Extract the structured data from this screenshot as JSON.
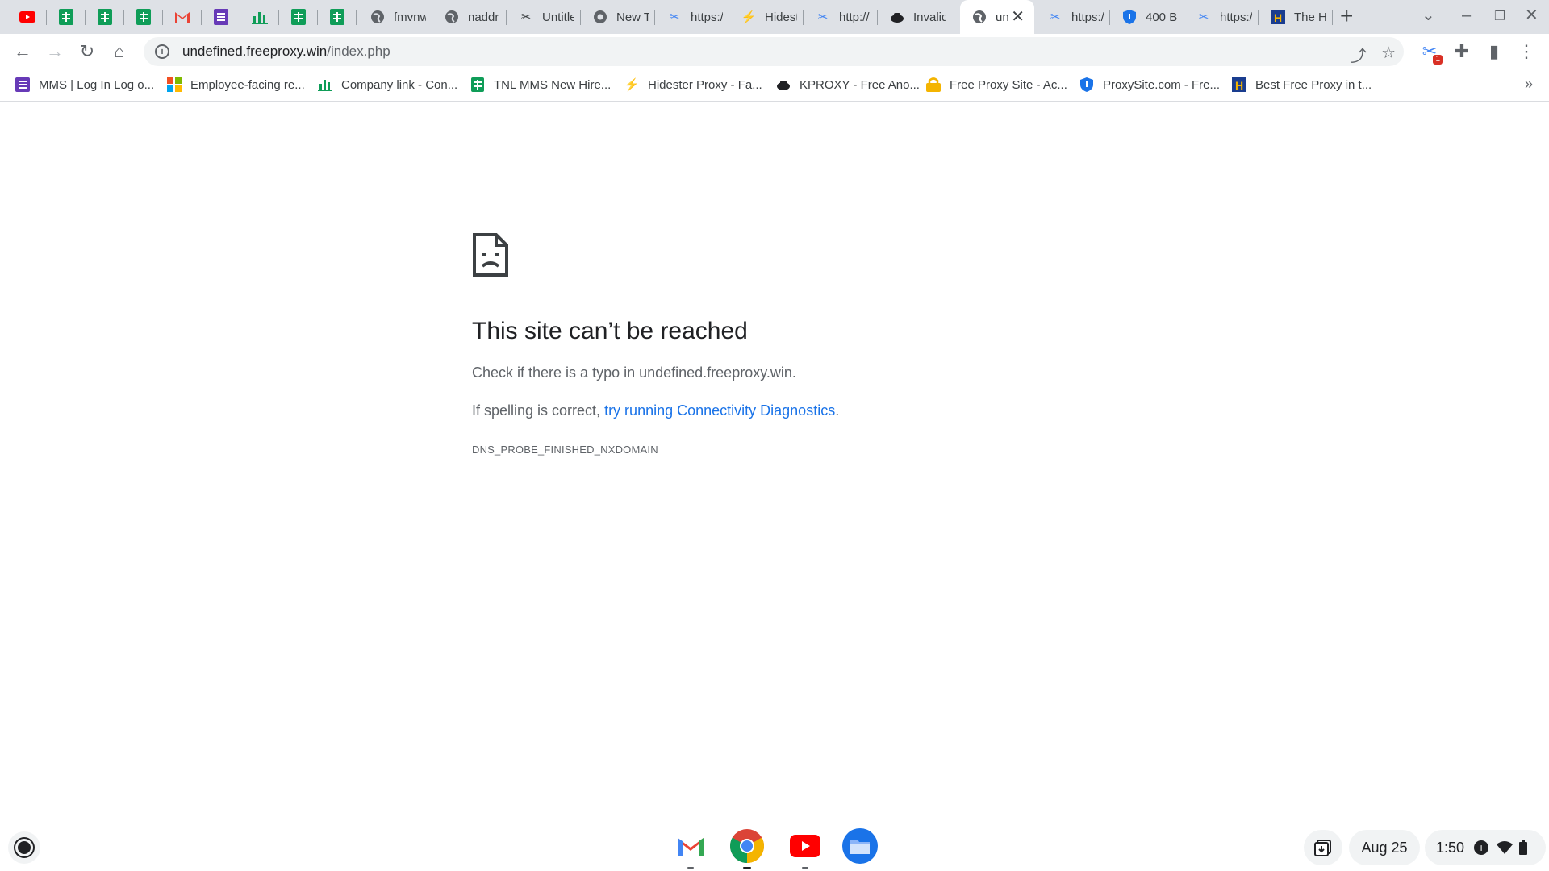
{
  "tabs": [
    {
      "icon": "youtube-icon",
      "label": ""
    },
    {
      "icon": "sheets-icon",
      "label": ""
    },
    {
      "icon": "sheets-icon",
      "label": ""
    },
    {
      "icon": "sheets-icon",
      "label": ""
    },
    {
      "icon": "gmail-icon",
      "label": ""
    },
    {
      "icon": "forms-icon",
      "label": ""
    },
    {
      "icon": "chart-icon",
      "label": ""
    },
    {
      "icon": "sheets-icon",
      "label": ""
    },
    {
      "icon": "sheets-icon",
      "label": ""
    },
    {
      "icon": "globe-icon",
      "label": "fmvnw"
    },
    {
      "icon": "globe-icon",
      "label": "naddr"
    },
    {
      "icon": "scissors-icon",
      "label": "Untitle"
    },
    {
      "icon": "chrome-icon",
      "label": "New T"
    },
    {
      "icon": "scissors-icon",
      "label": "https:/"
    },
    {
      "icon": "hidester-icon",
      "label": "Hidest"
    },
    {
      "icon": "scissors-icon",
      "label": "http://"
    },
    {
      "icon": "kproxy-icon",
      "label": "Invalid"
    },
    {
      "icon": "globe-icon",
      "label": "un"
    },
    {
      "icon": "scissors-icon",
      "label": "https:/"
    },
    {
      "icon": "shield-icon",
      "label": "400 B"
    },
    {
      "icon": "scissors-icon",
      "label": "https:/"
    },
    {
      "icon": "h-icon",
      "label": "The H"
    }
  ],
  "toolbar": {
    "url_host": "undefined.freeproxy.win",
    "url_path": "/index.php",
    "extension_badge": "1"
  },
  "bookmarks": [
    {
      "icon": "forms-icon",
      "label": "MMS | Log In Log o..."
    },
    {
      "icon": "microsoft-icon",
      "label": "Employee-facing re..."
    },
    {
      "icon": "chart-icon",
      "label": "Company link - Con..."
    },
    {
      "icon": "sheets-icon",
      "label": "TNL MMS New Hire..."
    },
    {
      "icon": "hidester-icon",
      "label": "Hidester Proxy - Fa..."
    },
    {
      "icon": "kproxy-icon",
      "label": "KPROXY - Free Ano..."
    },
    {
      "icon": "lock-icon",
      "label": "Free Proxy Site - Ac..."
    },
    {
      "icon": "shield-icon",
      "label": "ProxySite.com - Fre..."
    },
    {
      "icon": "h-icon",
      "label": "Best Free Proxy in t..."
    }
  ],
  "error": {
    "title": "This site can’t be reached",
    "line1": "Check if there is a typo in undefined.freeproxy.win.",
    "line2_prefix": "If spelling is correct, ",
    "line2_link": "try running Connectivity Diagnostics",
    "line2_suffix": ".",
    "code": "DNS_PROBE_FINISHED_NXDOMAIN"
  },
  "shelf": {
    "apps": [
      "gmail-icon",
      "chrome-icon",
      "youtube-icon",
      "files-icon"
    ],
    "date": "Aug 25",
    "time": "1:50"
  },
  "colors": {
    "link": "#1a73e8",
    "tabstrip_bg": "#dee1e6",
    "sheets_green": "#0f9d58",
    "youtube_red": "#ff0000"
  }
}
